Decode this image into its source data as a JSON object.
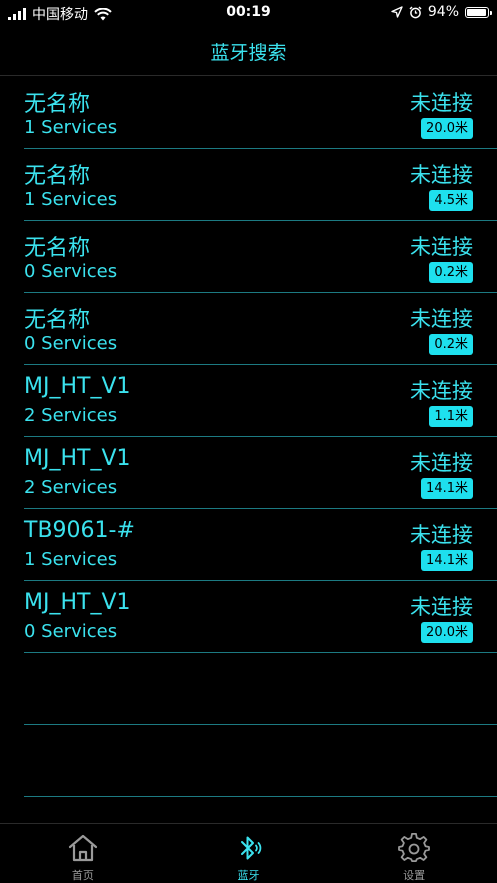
{
  "status_bar": {
    "carrier": "中国移动",
    "time": "00:19",
    "battery": "94%",
    "battery_level": 0.94
  },
  "nav": {
    "title": "蓝牙搜索"
  },
  "devices": [
    {
      "name": "无名称",
      "services": "1 Services",
      "status": "未连接",
      "distance": "20.0米"
    },
    {
      "name": "无名称",
      "services": "1 Services",
      "status": "未连接",
      "distance": "4.5米"
    },
    {
      "name": "无名称",
      "services": "0 Services",
      "status": "未连接",
      "distance": "0.2米"
    },
    {
      "name": "无名称",
      "services": "0 Services",
      "status": "未连接",
      "distance": "0.2米"
    },
    {
      "name": "MJ_HT_V1",
      "services": "2 Services",
      "status": "未连接",
      "distance": "1.1米"
    },
    {
      "name": "MJ_HT_V1",
      "services": "2 Services",
      "status": "未连接",
      "distance": "14.1米"
    },
    {
      "name": "TB9061-#",
      "services": "1 Services",
      "status": "未连接",
      "distance": "14.1米"
    },
    {
      "name": "MJ_HT_V1",
      "services": "0 Services",
      "status": "未连接",
      "distance": "20.0米"
    }
  ],
  "tabs": [
    {
      "label": "首页",
      "icon": "home-icon",
      "active": false
    },
    {
      "label": "蓝牙",
      "icon": "bluetooth-icon",
      "active": true
    },
    {
      "label": "设置",
      "icon": "gear-icon",
      "active": false
    }
  ],
  "colors": {
    "accent": "#3be2ee",
    "badge": "#1ee0ee",
    "divider": "#1c7a82",
    "background": "#000000",
    "inactive_tab": "#9a9a9a"
  }
}
